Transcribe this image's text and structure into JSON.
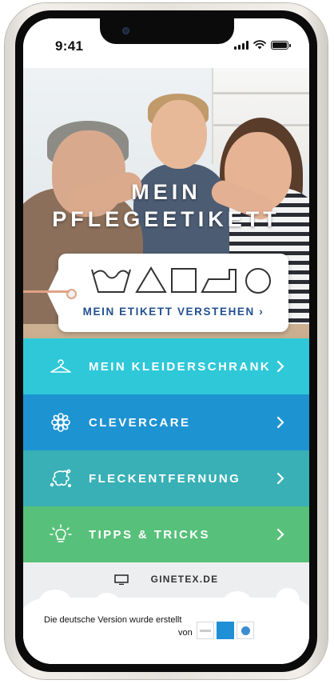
{
  "status_bar": {
    "time": "9:41"
  },
  "hero": {
    "title_line1": "MEIN",
    "title_line2": "PFLEGEETIKETT",
    "tag_link": "MEIN ETIKETT VERSTEHEN ›"
  },
  "menu": [
    {
      "label": "MEIN KLEIDERSCHRANK",
      "icon": "hanger-icon",
      "color": "#2ec8d8"
    },
    {
      "label": "CLEVERCARE",
      "icon": "flower-icon",
      "color": "#1e93d2"
    },
    {
      "label": "FLECKENTFERNUNG",
      "icon": "stain-icon",
      "color": "#38b0b6"
    },
    {
      "label": "TIPPS & TRICKS",
      "icon": "lightbulb-icon",
      "color": "#57c07a"
    }
  ],
  "footer": {
    "website": "GINETEX.DE",
    "credit": "Die deutsche Version wurde erstellt",
    "credit_von": "von"
  }
}
